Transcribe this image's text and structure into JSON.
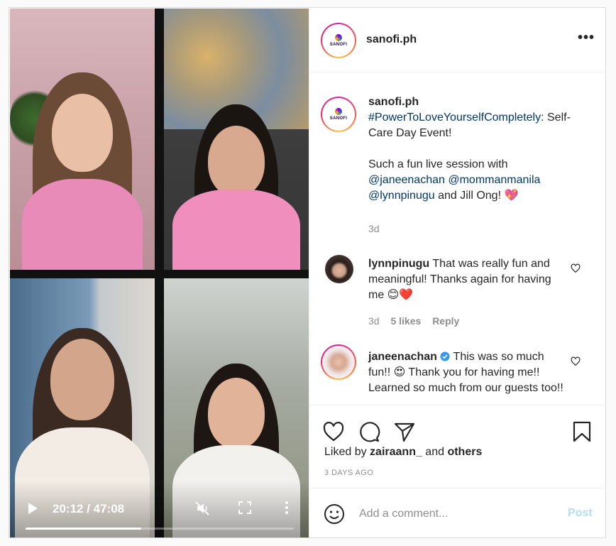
{
  "video": {
    "time_display": "20:12 / 47:08",
    "progress_fraction": 0.43,
    "participants": 4
  },
  "post": {
    "author": "sanofi.ph",
    "avatar_brand": "SANOFI",
    "more_icon": "more-horizontal-icon"
  },
  "caption": {
    "username": "sanofi.ph",
    "hashtag": "#PowerToLoveYourselfCompletely",
    "line1_rest": ": Self-Care Day Event!",
    "line2_start": "Such a fun live session with",
    "mention1": "@janeenachan",
    "mention2": "@mommanmanila",
    "mention3": "@lynnpinugu",
    "line2_end": " and Jill Ong! ",
    "emoji": "💖",
    "time": "3d"
  },
  "comments": [
    {
      "username": "lynnpinugu",
      "text": "That was really fun and meaningful! Thanks again for having me ",
      "emoji1": "😊",
      "emoji2": "❤️",
      "time": "3d",
      "likes": "5 likes",
      "reply": "Reply"
    },
    {
      "username": "janeenachan",
      "verified": true,
      "text1": " This was so much fun!! ",
      "emoji": "😍",
      "text2": " Thank you for having me!! Learned so much from our guests too!!"
    }
  ],
  "actions": {
    "liked_by_prefix": "Liked by ",
    "liked_by_user": "zairaann_",
    "liked_by_and": " and ",
    "liked_by_others": "others",
    "posted_ago": "3 DAYS AGO"
  },
  "add_comment": {
    "placeholder": "Add a comment...",
    "post_label": "Post"
  },
  "colors": {
    "link_blue": "#00376b",
    "post_disabled": "#b2dffc",
    "verified_blue": "#3897f0"
  }
}
